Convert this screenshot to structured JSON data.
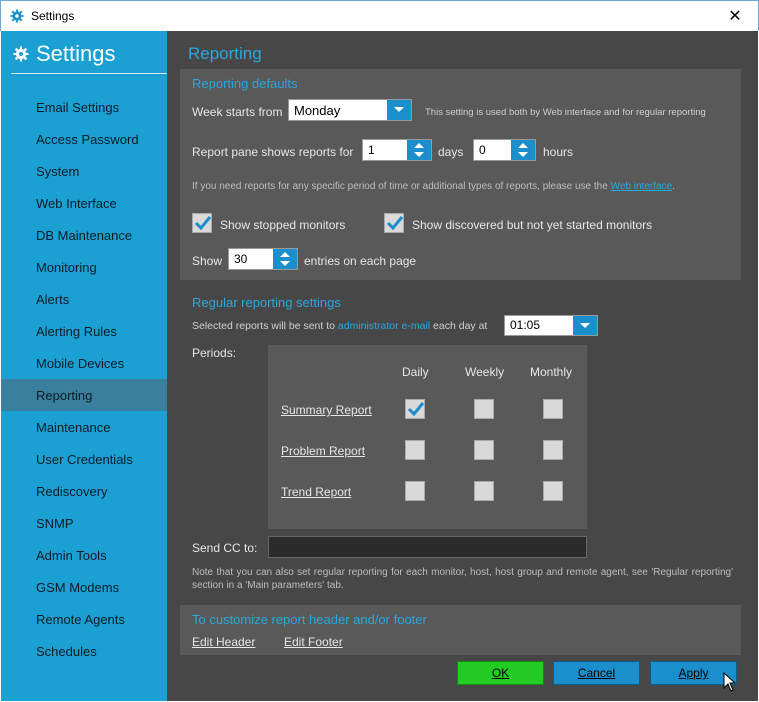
{
  "window": {
    "title": "Settings",
    "close_glyph": "✕"
  },
  "sidebar": {
    "title": "Settings",
    "icon": "gear-icon",
    "items": [
      "Email Settings",
      "Access Password",
      "System",
      "Web Interface",
      "DB Maintenance",
      "Monitoring",
      "Alerts",
      "Alerting Rules",
      "Mobile Devices",
      "Reporting",
      "Maintenance",
      "User Credentials",
      "Rediscovery",
      "SNMP",
      "Admin Tools",
      "GSM Modems",
      "Remote Agents",
      "Schedules"
    ],
    "active": "Reporting"
  },
  "page": {
    "title": "Reporting"
  },
  "defaults": {
    "title": "Reporting defaults",
    "week_label": "Week starts from",
    "week_value": "Monday",
    "week_note": "This setting is used both by Web interface and for regular reporting",
    "pane_label": "Report pane shows reports for",
    "days_value": "1",
    "days_label": "days",
    "hours_value": "0",
    "hours_label": "hours",
    "hint_prefix": "If you need reports for any specific period of time or additional types of reports, please use the",
    "hint_link": "Web interface",
    "hint_suffix": ".",
    "show_stopped": "Show stopped monitors",
    "show_discovered": "Show discovered but not yet started monitors",
    "show_label": "Show",
    "show_value": "30",
    "entries_label": "entries on each page"
  },
  "regular": {
    "title": "Regular reporting settings",
    "sent_prefix": "Selected reports will be sent to",
    "sent_link": "administrator e-mail",
    "sent_suffix": "each day at",
    "time_value": "01:05",
    "periods_label": "Periods:",
    "columns": [
      "Daily",
      "Weekly",
      "Monthly"
    ],
    "reports": [
      {
        "name": "Summary Report",
        "checks": [
          true,
          false,
          false
        ]
      },
      {
        "name": "Problem Report",
        "checks": [
          false,
          false,
          false
        ]
      },
      {
        "name": "Trend Report",
        "checks": [
          false,
          false,
          false
        ]
      }
    ],
    "cc_label": "Send CC to:",
    "cc_value": "",
    "note": "Note that you can also set regular reporting for each monitor, host, host group and remote agent, see 'Regular reporting' section in a 'Main parameters' tab."
  },
  "customize": {
    "title": "To customize report header and/or footer",
    "edit_header": "Edit Header",
    "edit_footer": "Edit Footer"
  },
  "buttons": {
    "ok": "OK",
    "cancel": "Cancel",
    "apply": "Apply"
  },
  "colors": {
    "accent": "#1ba0d4",
    "ok": "#22cc22",
    "bg": "#474747"
  }
}
